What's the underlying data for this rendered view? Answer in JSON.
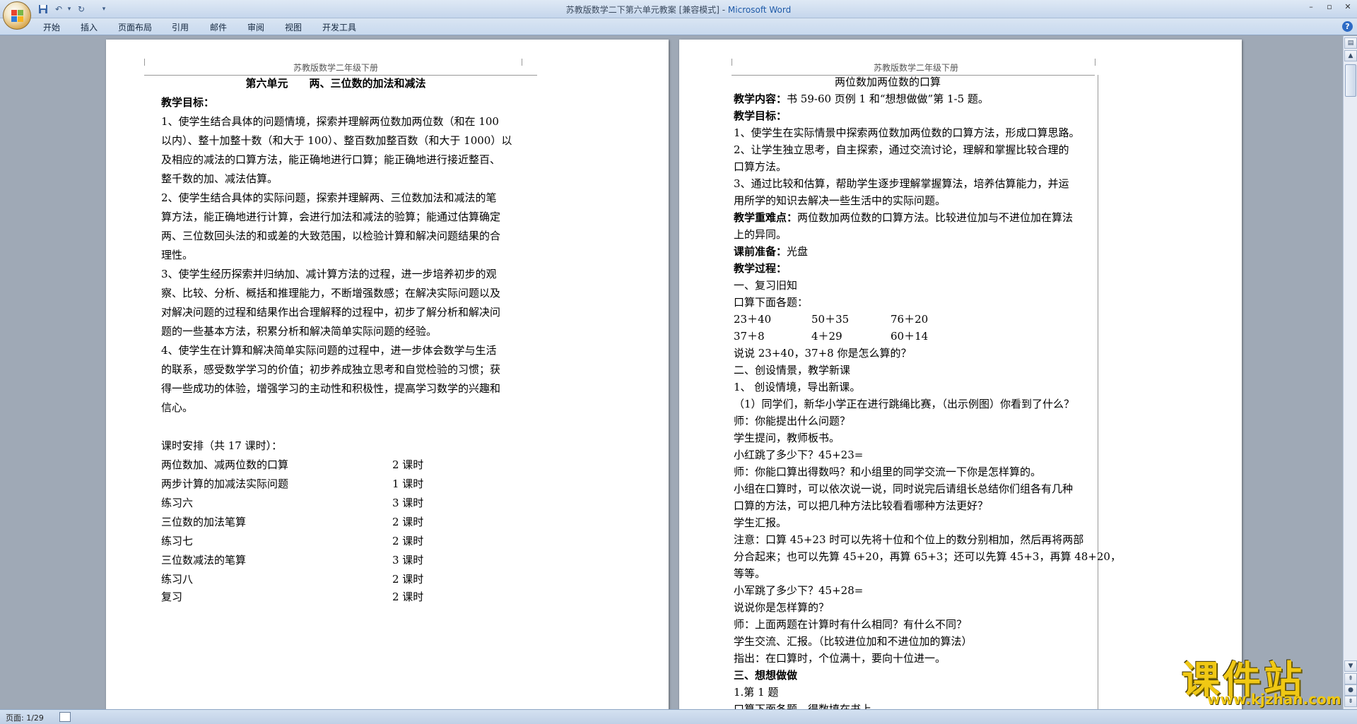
{
  "window": {
    "title": "苏教版数学二下第六单元教案 [兼容模式] - ",
    "app_name": "Microsoft Word"
  },
  "ribbon": {
    "tabs": [
      "开始",
      "插入",
      "页面布局",
      "引用",
      "邮件",
      "审阅",
      "视图",
      "开发工具"
    ]
  },
  "page1": {
    "header": "苏教版数学二年级下册",
    "title": "第六单元　　两、三位数的加法和减法",
    "lines": [
      "教学目标：",
      "1、使学生结合具体的问题情境，探索并理解两位数加两位数（和在  100",
      "以内）、整十加整十数（和大于 100）、整百数加整百数（和大于 1000）以",
      "及相应的减法的口算方法，能正确地进行口算；能正确地进行接近整百、",
      "整千数的加、减法估算。",
      "2、使学生结合具体的实际问题，探索并理解两、三位数加法和减法的笔",
      "算方法，能正确地进行计算，会进行加法和减法的验算；能通过估算确定",
      "两、三位数回头法的和或差的大致范围，以检验计算和解决问题结果的合",
      "理性。",
      "3、使学生经历探索并归纳加、减计算方法的过程，进一步培养初步的观",
      "察、比较、分析、概括和推理能力，不断增强数感；在解决实际问题以及",
      "对解决问题的过程和结果作出合理解释的过程中，初步了解分析和解决问",
      "题的一些基本方法，积累分析和解决简单实际问题的经验。",
      "4、使学生在计算和解决简单实际问题的过程中，进一步体会数学与生活",
      "的联系，感受数学学习的价值；初步养成独立思考和自觉检验的习惯；获",
      "得一些成功的体验，增强学习的主动性和积极性，提高学习数学的兴趣和",
      "信心。",
      "",
      "课时安排（共 17 课时）："
    ],
    "schedule": [
      {
        "name": "两位数加、减两位数的口算",
        "hours": "2 课时"
      },
      {
        "name": "两步计算的加减法实际问题",
        "hours": "1 课时"
      },
      {
        "name": "练习六",
        "hours": "3 课时"
      },
      {
        "name": "三位数的加法笔算",
        "hours": "2 课时"
      },
      {
        "name": "练习七",
        "hours": "2 课时"
      },
      {
        "name": "三位数减法的笔算",
        "hours": "3 课时"
      },
      {
        "name": "练习八",
        "hours": "2 课时"
      },
      {
        "name": "复习",
        "hours": "2 课时"
      }
    ]
  },
  "page2": {
    "header": "苏教版数学二年级下册",
    "title": "两位数加两位数的口算",
    "content_label": "教学内容：",
    "content_text": "书 59-60 页例 1 和“想想做做”第 1-5 题。",
    "goal_label": "教学目标：",
    "goals": [
      "1、使学生在实际情景中探索两位数加两位数的口算方法，形成口算思路。",
      "2、让学生独立思考，自主探索，通过交流讨论，理解和掌握比较合理的",
      "口算方法。",
      "3、通过比较和估算，帮助学生逐步理解掌握算法，培养估算能力，并运",
      "用所学的知识去解决一些生活中的实际问题。"
    ],
    "key_label": "教学重难点：",
    "key_text": "两位数加两位数的口算方法。比较进位加与不进位加在算法",
    "key_text2": "上的异同。",
    "prep_label": "课前准备：",
    "prep_text": "光盘",
    "process_label": "教学过程：",
    "review_title": "一、复习旧知",
    "review_intro": "口算下面各题：",
    "calc_row1": [
      "23＋40",
      "50＋35",
      "76＋20"
    ],
    "calc_row2": [
      "37＋8",
      "4＋29",
      "60＋14"
    ],
    "lines": [
      "说说 23+40，37+8 你是怎么算的？",
      "二、创设情景，教学新课",
      "1、 创设情境，导出新课。",
      "（1）同学们，新华小学正在进行跳绳比赛，（出示例图）你看到了什么？",
      "师：你能提出什么问题？",
      "学生提问，教师板书。",
      "小红跳了多少下？45+23=",
      "师：你能口算出得数吗？和小组里的同学交流一下你是怎样算的。",
      "小组在口算时，可以依次说一说，同时说完后请组长总结你们组各有几种",
      "口算的方法，可以把几种方法比较看看哪种方法更好？",
      "学生汇报。",
      "注意：口算 45+23 时可以先将十位和个位上的数分别相加，然后再将两部",
      "分合起来；也可以先算 45+20，再算 65+3；还可以先算 45+3，再算 48+20，",
      "等等。",
      "小军跳了多少下？45+28=",
      "说说你是怎样算的？",
      "师：上面两题在计算时有什么相同？有什么不同？",
      "学生交流、汇报。（比较进位加和不进位加的算法）",
      " 指出：在口算时，个位满十，要向十位进一。"
    ],
    "practice_title": "三、想想做做",
    "practice_first": "1.第 1 题",
    "practice_next": "口算下面各题，得数填在书上。"
  },
  "status": {
    "page_info": "页面: 1/29"
  },
  "watermark": {
    "text": "课件站",
    "url": "www.kjzhan.com"
  }
}
